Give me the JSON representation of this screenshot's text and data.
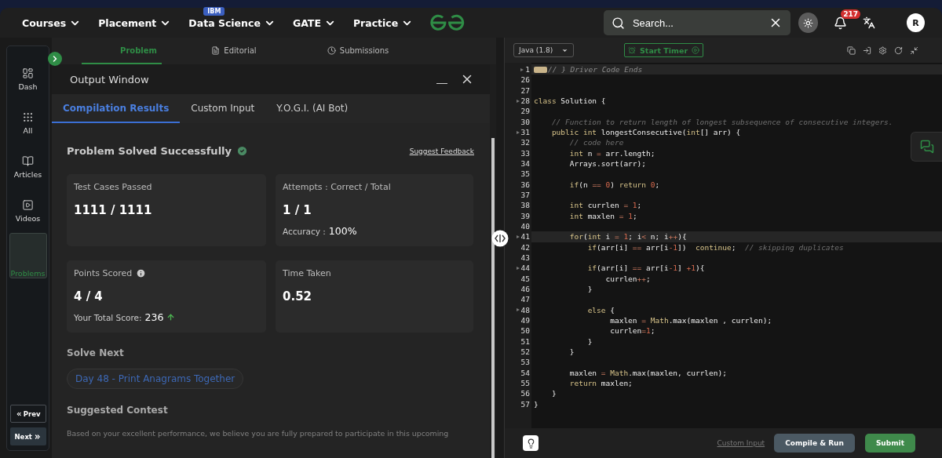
{
  "nav": {
    "items": [
      {
        "label": "Courses"
      },
      {
        "label": "Placement"
      },
      {
        "label": "Data Science",
        "badge": "IBM"
      },
      {
        "label": "GATE"
      },
      {
        "label": "Practice"
      }
    ],
    "search": {
      "placeholder": "Search..."
    },
    "notifications": "217",
    "avatar": "R"
  },
  "sidebar": {
    "items": [
      {
        "label": "Dash",
        "kind": "dash",
        "selected": false
      },
      {
        "label": "All",
        "kind": "all",
        "selected": false
      },
      {
        "label": "Articles",
        "kind": "book",
        "selected": false
      },
      {
        "label": "Videos",
        "kind": "video",
        "selected": false
      },
      {
        "label": "Problems",
        "kind": "code",
        "selected": true
      }
    ],
    "prev": "Prev",
    "next": "Next"
  },
  "problem_tabs": [
    {
      "label": "Problem",
      "kind": "code",
      "selected": true
    },
    {
      "label": "Editorial",
      "kind": "file",
      "selected": false
    },
    {
      "label": "Submissions",
      "kind": "clock",
      "selected": false
    }
  ],
  "output_window": {
    "title": "Output Window",
    "tabs": [
      {
        "label": "Compilation Results",
        "selected": true
      },
      {
        "label": "Custom Input",
        "selected": false
      },
      {
        "label": "Y.O.G.I. (AI Bot)",
        "selected": false
      }
    ],
    "status": "Problem Solved Successfully",
    "feedback_link": "Suggest Feedback",
    "cards": [
      {
        "label": "Test Cases Passed",
        "value": "1111 / 1111"
      },
      {
        "label": "Attempts : Correct / Total",
        "value": "1 / 1",
        "note_label": "Accuracy :",
        "note_value": "100%"
      },
      {
        "label": "Points Scored",
        "info": true,
        "value": "4 / 4",
        "note_label": "Your Total Score:",
        "note_value": "236",
        "trend_up": true
      },
      {
        "label": "Time Taken",
        "value": "0.52"
      }
    ],
    "solve_next": {
      "heading": "Solve Next",
      "problem": "Day 48 - Print Anagrams Together"
    },
    "contest": {
      "heading": "Suggested Contest",
      "text": "Based on your excellent performance, we believe you are fully prepared to participate in this upcoming"
    }
  },
  "editor": {
    "language": "Java (1.8)",
    "timer": "Start Timer",
    "lines": [
      {
        "number": "1",
        "fold": true,
        "active": true,
        "folded": true,
        "tokens": [
          {
            "text": "// } Driver Code Ends",
            "kind": "faded"
          }
        ]
      },
      {
        "number": "26",
        "fold": false,
        "active": false
      },
      {
        "number": "27",
        "fold": false,
        "active": false
      },
      {
        "number": "28",
        "fold": true,
        "active": false,
        "tokens": [
          {
            "text": "class",
            "kind": "keyword"
          },
          {
            "text": " Solution {",
            "kind": "plain"
          }
        ]
      },
      {
        "number": "29",
        "fold": false,
        "active": false
      },
      {
        "number": "30",
        "fold": false,
        "active": false,
        "tokens": [
          {
            "text": "    // Function to return length of longest subsequence of consecutive integers.",
            "kind": "comment"
          }
        ]
      },
      {
        "number": "31",
        "fold": true,
        "active": false,
        "tokens": [
          {
            "text": "    public int",
            "kind": "keyword"
          },
          {
            "text": " longestConsecutive(",
            "kind": "plain"
          },
          {
            "text": "int",
            "kind": "keyword"
          },
          {
            "text": "[] arr) {",
            "kind": "plain"
          }
        ]
      },
      {
        "number": "32",
        "fold": false,
        "active": false,
        "tokens": [
          {
            "text": "        // code here",
            "kind": "comment"
          }
        ]
      },
      {
        "number": "33",
        "fold": false,
        "active": false,
        "tokens": [
          {
            "text": "        int",
            "kind": "keyword"
          },
          {
            "text": " n ",
            "kind": "plain"
          },
          {
            "text": "=",
            "kind": "operator"
          },
          {
            "text": " arr.length;",
            "kind": "plain"
          }
        ]
      },
      {
        "number": "34",
        "fold": false,
        "active": false,
        "tokens": [
          {
            "text": "        Arrays.sort(arr);",
            "kind": "plain"
          }
        ]
      },
      {
        "number": "35",
        "fold": false,
        "active": false
      },
      {
        "number": "36",
        "fold": false,
        "active": false,
        "tokens": [
          {
            "text": "        if",
            "kind": "keyword"
          },
          {
            "text": "(n ",
            "kind": "plain"
          },
          {
            "text": "==",
            "kind": "operator"
          },
          {
            "text": " 0",
            "kind": "number"
          },
          {
            "text": ") ",
            "kind": "plain"
          },
          {
            "text": "return",
            "kind": "keyword"
          },
          {
            "text": " 0",
            "kind": "number"
          },
          {
            "text": ";",
            "kind": "plain"
          }
        ]
      },
      {
        "number": "37",
        "fold": false,
        "active": false
      },
      {
        "number": "38",
        "fold": false,
        "active": false,
        "tokens": [
          {
            "text": "        int",
            "kind": "keyword"
          },
          {
            "text": " currlen ",
            "kind": "plain"
          },
          {
            "text": "=",
            "kind": "operator"
          },
          {
            "text": " 1",
            "kind": "number"
          },
          {
            "text": ";",
            "kind": "plain"
          }
        ]
      },
      {
        "number": "39",
        "fold": false,
        "active": false,
        "tokens": [
          {
            "text": "        int",
            "kind": "keyword"
          },
          {
            "text": " maxlen ",
            "kind": "plain"
          },
          {
            "text": "=",
            "kind": "operator"
          },
          {
            "text": " 1",
            "kind": "number"
          },
          {
            "text": ";",
            "kind": "plain"
          }
        ]
      },
      {
        "number": "40",
        "fold": false,
        "active": false
      },
      {
        "number": "41",
        "fold": true,
        "active": true,
        "tokens": [
          {
            "text": "        for",
            "kind": "keyword"
          },
          {
            "text": "(",
            "kind": "plain"
          },
          {
            "text": "int",
            "kind": "keyword"
          },
          {
            "text": " i ",
            "kind": "plain"
          },
          {
            "text": "=",
            "kind": "operator"
          },
          {
            "text": " 1",
            "kind": "number"
          },
          {
            "text": "; i",
            "kind": "plain"
          },
          {
            "text": "<",
            "kind": "operator"
          },
          {
            "text": " n; i",
            "kind": "plain"
          },
          {
            "text": "++",
            "kind": "operator"
          },
          {
            "text": "){",
            "kind": "plain"
          }
        ]
      },
      {
        "number": "42",
        "fold": false,
        "active": false,
        "tokens": [
          {
            "text": "            if",
            "kind": "keyword"
          },
          {
            "text": "(arr[i] ",
            "kind": "plain"
          },
          {
            "text": "==",
            "kind": "operator"
          },
          {
            "text": " arr[i",
            "kind": "plain"
          },
          {
            "text": "-1",
            "kind": "number"
          },
          {
            "text": "])  ",
            "kind": "plain"
          },
          {
            "text": "continue",
            "kind": "keyword"
          },
          {
            "text": ";  ",
            "kind": "plain"
          },
          {
            "text": "// skipping duplicates",
            "kind": "comment"
          }
        ]
      },
      {
        "number": "43",
        "fold": false,
        "active": false
      },
      {
        "number": "44",
        "fold": true,
        "active": false,
        "tokens": [
          {
            "text": "            if",
            "kind": "keyword"
          },
          {
            "text": "(arr[i] ",
            "kind": "plain"
          },
          {
            "text": "==",
            "kind": "operator"
          },
          {
            "text": " arr[i",
            "kind": "plain"
          },
          {
            "text": "-1",
            "kind": "number"
          },
          {
            "text": "] ",
            "kind": "plain"
          },
          {
            "text": "+1",
            "kind": "number"
          },
          {
            "text": "){",
            "kind": "plain"
          }
        ]
      },
      {
        "number": "45",
        "fold": false,
        "active": false,
        "tokens": [
          {
            "text": "                currlen",
            "kind": "plain"
          },
          {
            "text": "++",
            "kind": "operator"
          },
          {
            "text": ";",
            "kind": "plain"
          }
        ]
      },
      {
        "number": "46",
        "fold": false,
        "active": false,
        "tokens": [
          {
            "text": "            }",
            "kind": "plain"
          }
        ]
      },
      {
        "number": "47",
        "fold": false,
        "active": false
      },
      {
        "number": "48",
        "fold": true,
        "active": false,
        "tokens": [
          {
            "text": "            else",
            "kind": "keyword"
          },
          {
            "text": " {",
            "kind": "plain"
          }
        ]
      },
      {
        "number": "49",
        "fold": false,
        "active": false,
        "tokens": [
          {
            "text": "                 maxlen ",
            "kind": "plain"
          },
          {
            "text": "=",
            "kind": "operator"
          },
          {
            "text": " Math",
            "kind": "keyword"
          },
          {
            "text": ".max(maxlen , currlen);",
            "kind": "plain"
          }
        ]
      },
      {
        "number": "50",
        "fold": false,
        "active": false,
        "tokens": [
          {
            "text": "                 currlen",
            "kind": "plain"
          },
          {
            "text": "=",
            "kind": "operator"
          },
          {
            "text": "1",
            "kind": "number"
          },
          {
            "text": ";",
            "kind": "plain"
          }
        ]
      },
      {
        "number": "51",
        "fold": false,
        "active": false,
        "tokens": [
          {
            "text": "            }",
            "kind": "plain"
          }
        ]
      },
      {
        "number": "52",
        "fold": false,
        "active": false,
        "tokens": [
          {
            "text": "        }",
            "kind": "plain"
          }
        ]
      },
      {
        "number": "53",
        "fold": false,
        "active": false
      },
      {
        "number": "54",
        "fold": false,
        "active": false,
        "tokens": [
          {
            "text": "        maxlen ",
            "kind": "plain"
          },
          {
            "text": "=",
            "kind": "operator"
          },
          {
            "text": " Math",
            "kind": "keyword"
          },
          {
            "text": ".max(maxlen, currlen);",
            "kind": "plain"
          }
        ]
      },
      {
        "number": "55",
        "fold": false,
        "active": false,
        "tokens": [
          {
            "text": "        return",
            "kind": "keyword"
          },
          {
            "text": " maxlen;",
            "kind": "plain"
          }
        ]
      },
      {
        "number": "56",
        "fold": false,
        "active": false,
        "tokens": [
          {
            "text": "    }",
            "kind": "plain"
          }
        ]
      },
      {
        "number": "57",
        "fold": false,
        "active": false,
        "tokens": [
          {
            "text": "}",
            "kind": "plain"
          }
        ]
      }
    ],
    "custom_input": "Custom Input",
    "compile": "Compile & Run",
    "submit": "Submit"
  }
}
